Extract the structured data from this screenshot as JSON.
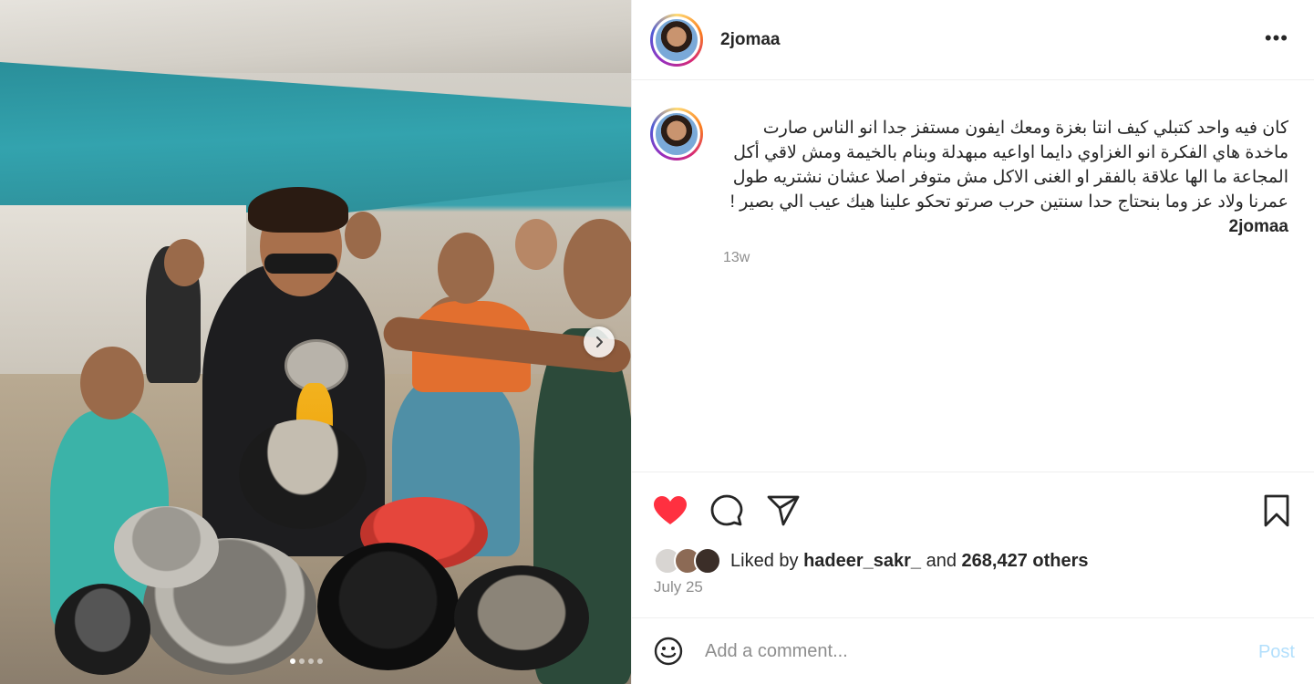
{
  "post": {
    "username": "2jomaa",
    "more_label": "•••",
    "caption_user": "2jomaa",
    "caption_text": "كان فيه واحد كتبلي كيف انتا بغزة ومعك ايفون مستفز جدا انو الناس صارت ماخدة هاي الفكرة انو الغزاوي دايما اواعيه مبهدلة وبنام بالخيمة ومش لاقي أكل المجاعة ما الها علاقة بالفقر او الغنى الاكل مش متوفر اصلا عشان نشتريه طول عمرنا ولاد عز وما بنحتاج حدا سنتين حرب صرتو تحكو علينا هيك عيب الي بصير !",
    "time_ago": "13w",
    "liked_by_prefix": "Liked by",
    "liked_by_user": "hadeer_sakr_",
    "liked_by_and": "and",
    "liked_by_count": "268,427 others",
    "date": "July 25"
  },
  "comment": {
    "placeholder": "Add a comment...",
    "post_label": "Post"
  },
  "media": {
    "slide_count": 4,
    "active_slide": 0
  },
  "icons": {
    "like": "heart-filled-icon",
    "comment": "comment-icon",
    "share": "share-icon",
    "save": "bookmark-icon",
    "emoji": "emoji-icon",
    "next": "chevron-right-icon"
  },
  "colors": {
    "like_red": "#ff3040",
    "post_blue_disabled": "#b2dffc",
    "muted_text": "#8e8e8e"
  }
}
